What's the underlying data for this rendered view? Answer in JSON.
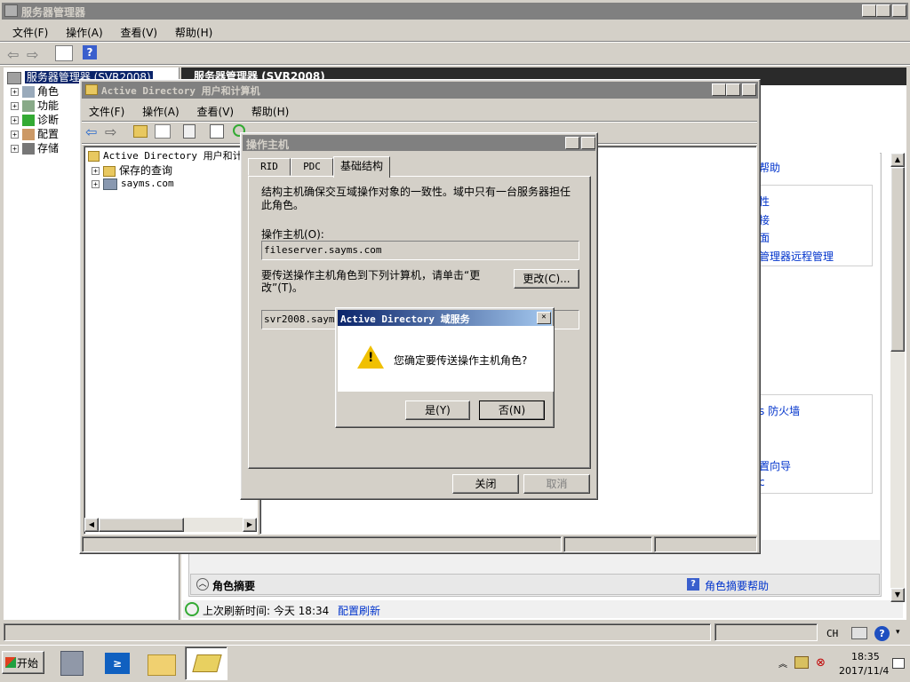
{
  "main_window": {
    "title": "服务器管理器",
    "menu": [
      "文件(F)",
      "操作(A)",
      "查看(V)",
      "帮助(H)"
    ],
    "tree": {
      "root": "服务器管理器 (SVR2008)",
      "items": [
        "角色",
        "功能",
        "诊断",
        "配置",
        "存储"
      ]
    },
    "right_header": "服务器管理器 (SVR2008)",
    "right_links": [
      "帮助",
      "性",
      "接",
      "面",
      "管理器远程管理",
      "s 防火墙",
      "置向导",
      "c"
    ],
    "role_summary": "角色摘要",
    "role_summary_help": "角色摘要帮助",
    "refresh_text": "上次刷新时间: 今天 18:34",
    "refresh_link": "配置刷新"
  },
  "ad_window": {
    "title": "Active Directory 用户和计算机",
    "menu": [
      "文件(F)",
      "操作(A)",
      "查看(V)",
      "帮助(H)"
    ],
    "tree": {
      "root": "Active Directory 用户和计",
      "items": [
        "保存的查询",
        "sayms.com"
      ]
    }
  },
  "ops_dialog": {
    "title": "操作主机",
    "help_btn": "?",
    "close_btn": "✕",
    "tabs": [
      "RID",
      "PDC",
      "基础结构"
    ],
    "description": "结构主机确保交互域操作对象的一致性。域中只有一台服务器担任此角色。",
    "desc_line1": "结构主机确保交互域操作对象的一致性。域中只有一台服务器担任",
    "desc_line2": "此角色。",
    "master_label": "操作主机(O):",
    "master_value": "fileserver.sayms.com",
    "transfer_line1": "要传送操作主机角色到下列计算机，请单击“更",
    "transfer_line2": "改”(T)。",
    "change_btn": "更改(C)...",
    "target_value": "svr2008.sayms.com",
    "close_button": "关闭",
    "cancel_button": "取消"
  },
  "confirm_dialog": {
    "title": "Active Directory 域服务",
    "message": "您确定要传送操作主机角色?",
    "yes": "是(Y)",
    "no": "否(N)"
  },
  "statusbar": {
    "lang": "CH"
  },
  "taskbar": {
    "start": "开始",
    "time": "18:35",
    "date": "2017/11/4"
  },
  "colors": {
    "title_active": "#0a246a",
    "title_inactive": "#808080",
    "link": "#0033cc"
  }
}
